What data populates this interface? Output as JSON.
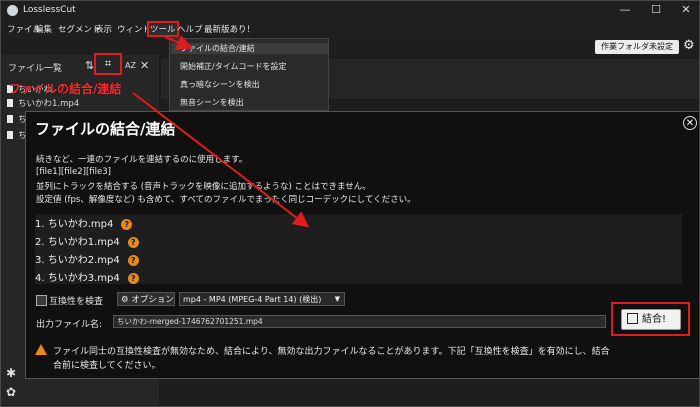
{
  "window": {
    "title": "LosslessCut",
    "minimize": "—",
    "maximize": "☐",
    "close": "✕"
  },
  "menu": {
    "items": [
      "ファイル",
      "編集",
      "セグメント",
      "表示",
      "ウィンドウ",
      "ツール",
      "ヘルプ",
      "最新版あり！"
    ],
    "active": "ツール"
  },
  "tools_menu": [
    "ファイルの結合/連結",
    "開始補正/タイムコードを設定",
    "真っ暗なシーンを検出",
    "無音シーンを検出"
  ],
  "top_right": {
    "project_folder_button": "作業フォルダ未設定",
    "settings_icon": "gear-icon"
  },
  "left_panel": {
    "title": "ファイル一覧",
    "files": [
      "ちいかわ",
      "ちいかわ1.mp4",
      "ち",
      "ち"
    ]
  },
  "annotation": {
    "label": "ファイルの結合/連結",
    "color": "#e01d1d"
  },
  "dialog": {
    "title": "ファイルの結合/連結",
    "description": [
      "続きなど、一連のファイルを連結するのに使用します。",
      "[file1][file2][file3]",
      "並列にトラックを結合する (音声トラックを映像に追加するような) ことはできません。",
      "設定値 (fps、解像度など) も含めて、すべてのファイルでまったく同じコーデックにしてください。"
    ],
    "files": [
      "1. ちいかわ.mp4",
      "2. ちいかわ1.mp4",
      "3. ちいかわ2.mp4",
      "4. ちいかわ3.mp4"
    ],
    "compat_check_label": "互換性を検査",
    "options_button": "オプション",
    "format_select": "mp4 - MP4 (MPEG-4 Part 14) (検出)",
    "output_label": "出力ファイル名:",
    "output_value": "ちいかわ-merged-1746762701251.mp4",
    "merge_button": "結合!",
    "warning": [
      "ファイル同士の互換性検査が無効なため、結合により、無効な出力ファイルなることがあります。下記「互換性を検査」を有効にし、結合",
      "合前に検査してください。"
    ]
  }
}
